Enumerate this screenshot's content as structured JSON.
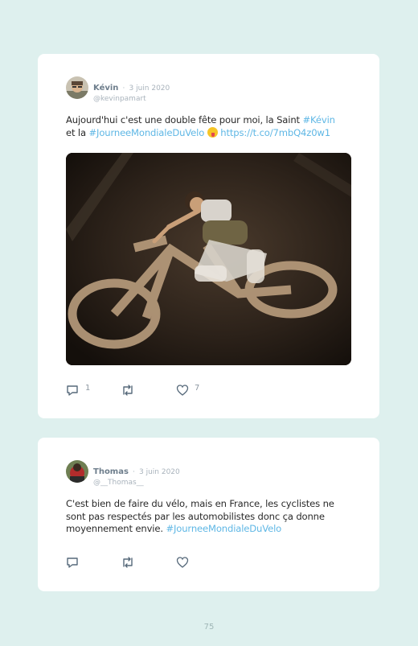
{
  "tweets": [
    {
      "author_name": "Kévin",
      "separator": "·",
      "date": "3 juin 2020",
      "handle": "@kevinpamart",
      "text_before_hashtag1": "Aujourd'hui c'est une double fête pour moi, la Saint ",
      "hashtag1": "#Kévin",
      "text_line2_start": "et la ",
      "hashtag2": "#JourneeMondialeDuVelo",
      "emoji_icon": "winking-face-with-tongue-icon",
      "link": "https://t.co/7mbQ4z0w1",
      "replies": "1",
      "likes": "7"
    },
    {
      "author_name": "Thomas",
      "separator": "·",
      "date": "3 juin 2020",
      "handle": "@__Thomas__",
      "text_line1": "C'est bien de faire du vélo, mais en France, les cyclistes ne",
      "text_line2": "sont pas respectés par les automobilistes donc ça donne",
      "text_line3_start": "moyennement envie. ",
      "hashtag": "#JourneeMondialeDuVelo"
    }
  ],
  "page_number": "75",
  "colors": {
    "background": "#def0ee",
    "card": "#ffffff",
    "link": "#5fb7e5",
    "muted": "#a9b3bc"
  }
}
